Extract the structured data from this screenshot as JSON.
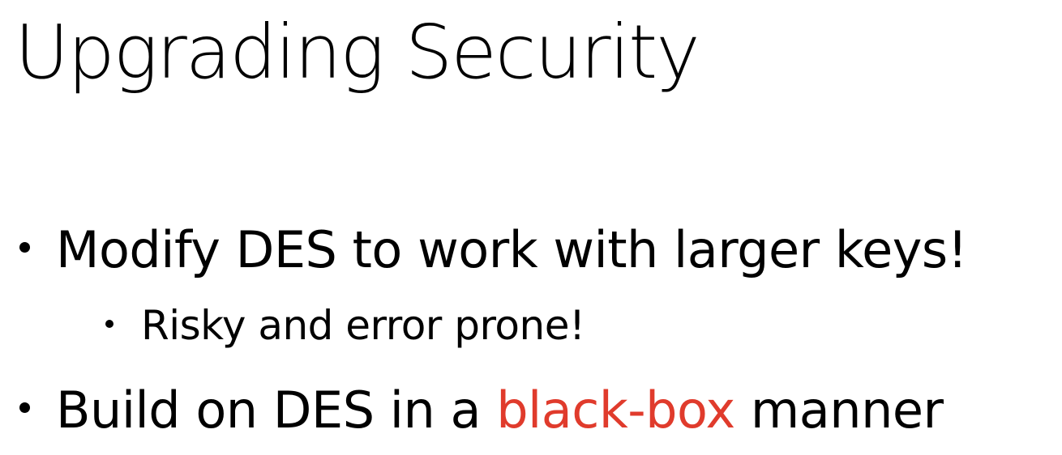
{
  "slide": {
    "title": "Upgrading Security",
    "bullets": [
      {
        "level": 1,
        "text": "Modify DES to work with larger keys!"
      },
      {
        "level": 2,
        "text": "Risky and error prone!"
      },
      {
        "level": 1,
        "text_before": "Build on DES in a ",
        "highlight": "black-box",
        "text_after": " manner"
      }
    ],
    "colors": {
      "text": "#000000",
      "highlight": "#e03b2c",
      "background": "#ffffff"
    }
  }
}
